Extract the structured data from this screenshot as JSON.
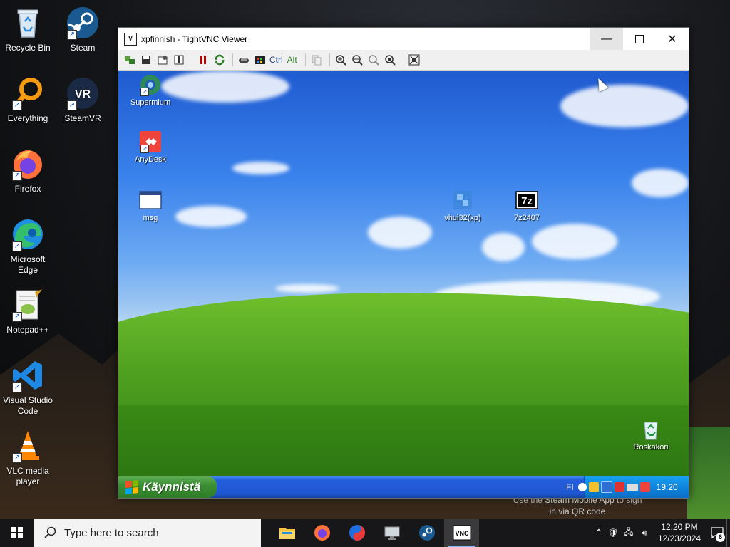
{
  "desktop": {
    "icons": [
      {
        "label": "Recycle Bin"
      },
      {
        "label": "Steam"
      },
      {
        "label": "Everything"
      },
      {
        "label": "SteamVR"
      },
      {
        "label": "Firefox"
      },
      {
        "label": "Microsoft Edge"
      },
      {
        "label": "Notepad++"
      },
      {
        "label": "Visual Studio Code"
      },
      {
        "label": "VLC media player"
      }
    ],
    "steam_notice_line1_pre": "Use the ",
    "steam_notice_link": "Steam Mobile App",
    "steam_notice_line1_post": " to sign",
    "steam_notice_line2": "in via QR code"
  },
  "vnc_window": {
    "title": "xpfinnish - TightVNC Viewer",
    "toolbar_ctrl": "Ctrl",
    "toolbar_alt": "Alt",
    "remote": {
      "icons": [
        {
          "label": "Supermium"
        },
        {
          "label": "AnyDesk"
        },
        {
          "label": "msg"
        },
        {
          "label": "vhui32(xp)"
        },
        {
          "label": "7z2407"
        },
        {
          "label": "Roskakori"
        }
      ],
      "start_label": "Käynnistä",
      "lang": "FI",
      "clock": "19:20"
    }
  },
  "taskbar": {
    "search_placeholder": "Type here to search",
    "time": "12:20 PM",
    "date": "12/23/2024",
    "notification_count": "6"
  }
}
